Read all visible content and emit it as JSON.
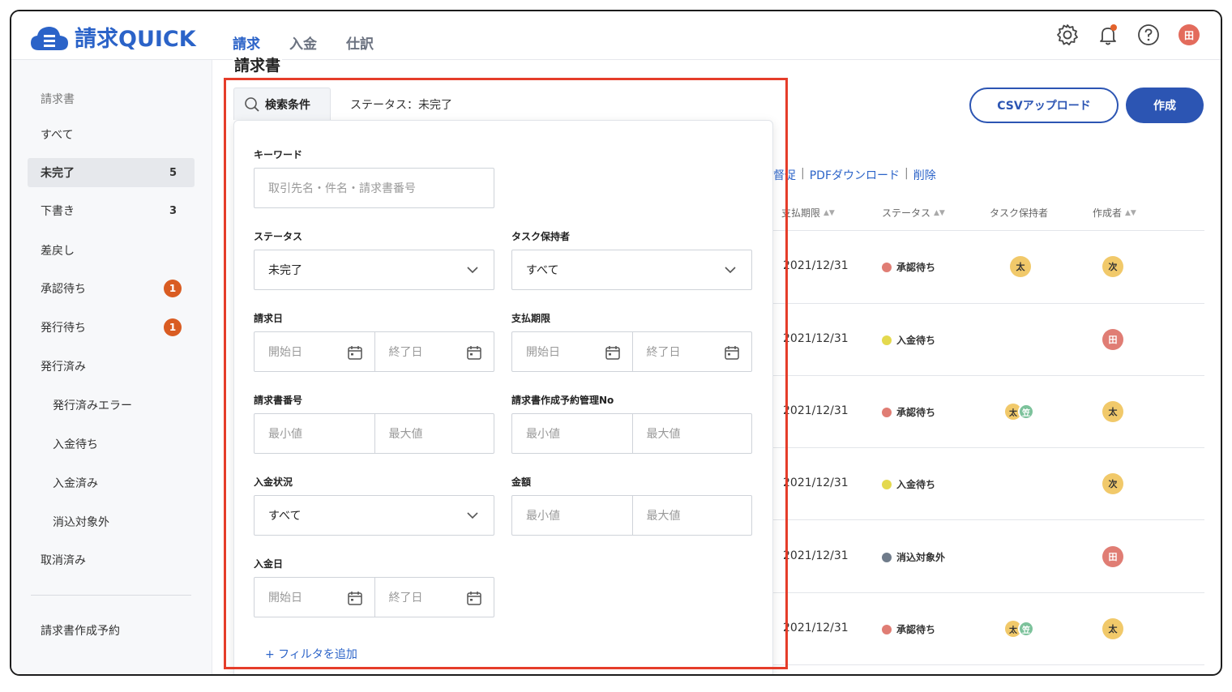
{
  "app": {
    "name": "請求QUICK"
  },
  "nav": {
    "tabs": [
      {
        "label": "請求"
      },
      {
        "label": "入金"
      },
      {
        "label": "仕訳"
      }
    ]
  },
  "header": {
    "avatar": "田"
  },
  "sidebar": {
    "section": "請求書",
    "items": [
      {
        "label": "すべて"
      },
      {
        "label": "未完了",
        "count": "5"
      },
      {
        "label": "下書き",
        "count": "3"
      },
      {
        "label": "差戻し"
      },
      {
        "label": "承認待ち",
        "badge": "1"
      },
      {
        "label": "発行待ち",
        "badge": "1"
      },
      {
        "label": "発行済み"
      },
      {
        "label": "発行済みエラー"
      },
      {
        "label": "入金待ち"
      },
      {
        "label": "入金済み"
      },
      {
        "label": "消込対象外"
      },
      {
        "label": "取消済み"
      }
    ],
    "footer_item": "請求書作成予約"
  },
  "main": {
    "title": "請求書",
    "search_tab": "検索条件",
    "status_text": "ステータス：未完了",
    "csv_button": "CSVアップロード",
    "create_button": "作成",
    "bulk_links": [
      "督促",
      "PDFダウンロード",
      "削除"
    ],
    "columns": [
      "支払期限",
      "ステータス",
      "タスク保持者",
      "作成者"
    ],
    "rows": [
      {
        "date": "2021/12/31",
        "status": "承認待ち",
        "dot": "#e07d74",
        "holders": [
          "太"
        ],
        "creator": "次",
        "creator_color": "y"
      },
      {
        "date": "2021/12/31",
        "status": "入金待ち",
        "dot": "#e4d94e",
        "holders": [],
        "creator": "田",
        "creator_color": "r"
      },
      {
        "date": "2021/12/31",
        "status": "承認待ち",
        "dot": "#e07d74",
        "holders": [
          "太",
          "笠"
        ],
        "creator": "太",
        "creator_color": "y"
      },
      {
        "date": "2021/12/31",
        "status": "入金待ち",
        "dot": "#e4d94e",
        "holders": [],
        "creator": "次",
        "creator_color": "y"
      },
      {
        "date": "2021/12/31",
        "status": "消込対象外",
        "dot": "#6f7b8a",
        "holders": [],
        "creator": "田",
        "creator_color": "r"
      },
      {
        "date": "2021/12/31",
        "status": "承認待ち",
        "dot": "#e07d74",
        "holders": [
          "太",
          "笠"
        ],
        "creator": "太",
        "creator_color": "y"
      }
    ]
  },
  "search": {
    "keyword_label": "キーワード",
    "keyword_placeholder": "取引先名・件名・請求書番号",
    "status_label": "ステータス",
    "status_value": "未完了",
    "holder_label": "タスク保持者",
    "holder_value": "すべて",
    "invoice_date_label": "請求日",
    "due_date_label": "支払期限",
    "start_placeholder": "開始日",
    "end_placeholder": "終了日",
    "invoice_no_label": "請求書番号",
    "reserve_no_label": "請求書作成予約管理No",
    "min_placeholder": "最小値",
    "max_placeholder": "最大値",
    "payment_status_label": "入金状況",
    "payment_status_value": "すべて",
    "amount_label": "金額",
    "payment_date_label": "入金日",
    "add_filter": "+ フィルタを追加"
  },
  "colors": {
    "accent": "#2c55b3",
    "highlight": "#e53d2a",
    "badge": "#d95c22"
  }
}
